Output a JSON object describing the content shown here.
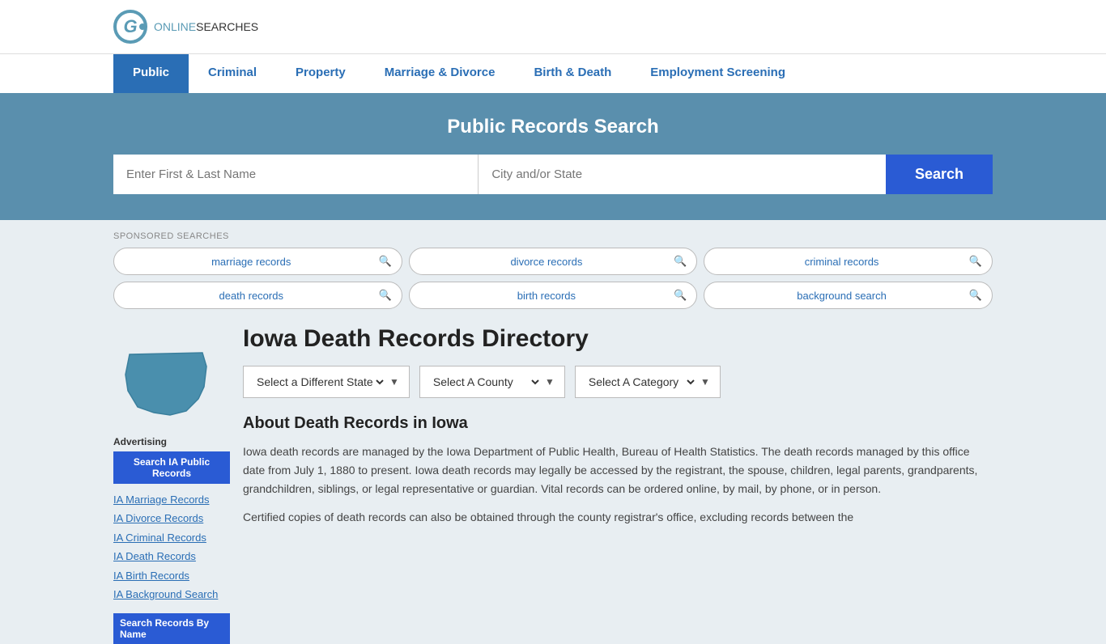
{
  "header": {
    "logo_online": "ONLINE",
    "logo_searches": "SEARCHES"
  },
  "nav": {
    "items": [
      {
        "label": "Public",
        "active": true
      },
      {
        "label": "Criminal",
        "active": false
      },
      {
        "label": "Property",
        "active": false
      },
      {
        "label": "Marriage & Divorce",
        "active": false
      },
      {
        "label": "Birth & Death",
        "active": false
      },
      {
        "label": "Employment Screening",
        "active": false
      }
    ]
  },
  "hero": {
    "title": "Public Records Search",
    "name_placeholder": "Enter First & Last Name",
    "location_placeholder": "City and/or State",
    "search_label": "Search"
  },
  "sponsored": {
    "label": "SPONSORED SEARCHES",
    "pills": [
      {
        "text": "marriage records"
      },
      {
        "text": "divorce records"
      },
      {
        "text": "criminal records"
      },
      {
        "text": "death records"
      },
      {
        "text": "birth records"
      },
      {
        "text": "background search"
      }
    ]
  },
  "iowa": {
    "title": "Iowa Death Records Directory",
    "dropdowns": {
      "state_label": "Select a Different State",
      "county_label": "Select A County",
      "category_label": "Select A Category"
    },
    "about_title": "About Death Records in Iowa",
    "about_p1": "Iowa death records are managed by the Iowa Department of Public Health, Bureau of Health Statistics. The death records managed by this office date from July 1, 1880 to present. Iowa death records may legally be accessed by the registrant, the spouse, children, legal parents, grandparents, grandchildren, siblings, or legal representative or guardian. Vital records can be ordered online, by mail, by phone, or in person.",
    "about_p2": "Certified copies of death records can also be obtained through the county registrar's office, excluding records between the"
  },
  "sidebar": {
    "ad_label": "Advertising",
    "search_btn": "Search IA Public Records",
    "links": [
      {
        "text": "IA Marriage Records"
      },
      {
        "text": "IA Divorce Records"
      },
      {
        "text": "IA Criminal Records"
      },
      {
        "text": "IA Death Records"
      },
      {
        "text": "IA Birth Records"
      },
      {
        "text": "IA Background Search"
      }
    ],
    "by_name_label": "Search Records By Name"
  }
}
